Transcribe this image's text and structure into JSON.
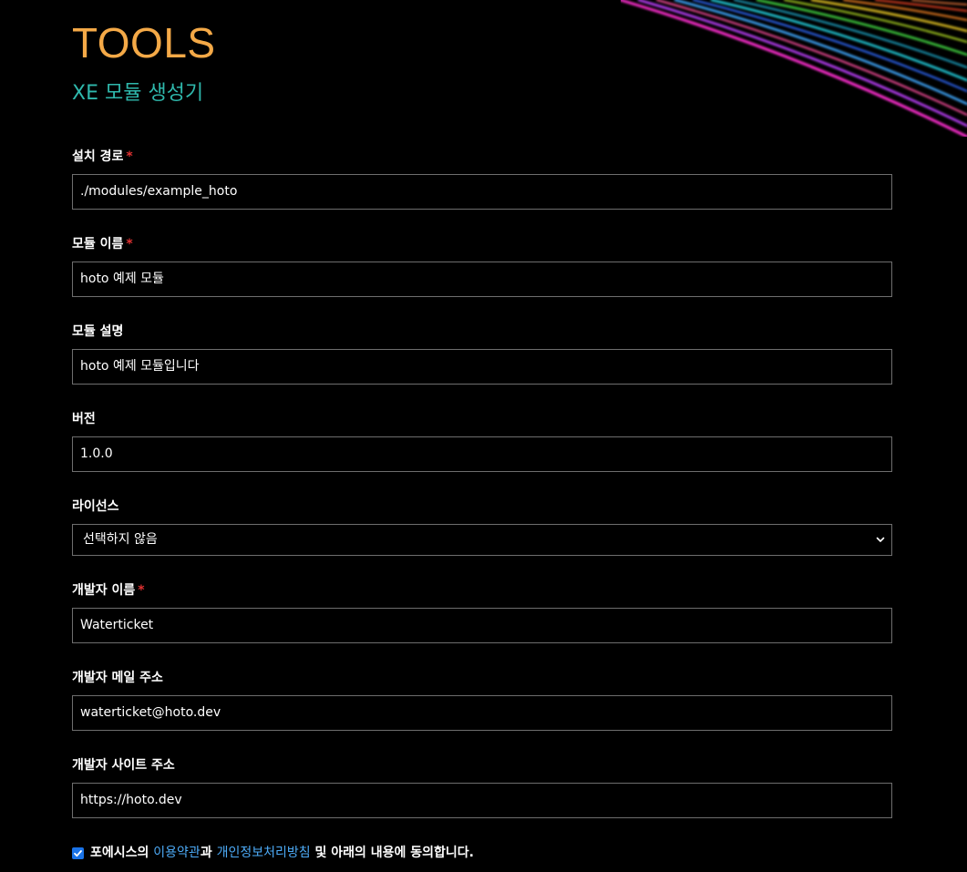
{
  "header": {
    "title": "TOOLS",
    "subtitle": "XE 모듈 생성기"
  },
  "fields": {
    "install_path": {
      "label": "설치 경로",
      "required_mark": "*",
      "value": "./modules/example_hoto"
    },
    "module_name": {
      "label": "모듈 이름",
      "required_mark": "*",
      "value": "hoto 예제 모듈"
    },
    "module_desc": {
      "label": "모듈 설명",
      "value": "hoto 예제 모듈입니다"
    },
    "version": {
      "label": "버전",
      "value": "1.0.0"
    },
    "license": {
      "label": "라이선스",
      "selected": "선택하지 않음"
    },
    "dev_name": {
      "label": "개발자 이름",
      "required_mark": "*",
      "value": "Waterticket"
    },
    "dev_email": {
      "label": "개발자 메일 주소",
      "value": "waterticket@hoto.dev"
    },
    "dev_site": {
      "label": "개발자 사이트 주소",
      "value": "https://hoto.dev"
    }
  },
  "consent": {
    "checked": true,
    "prefix": "포에시스의 ",
    "terms_link": "이용약관",
    "connector": "과 ",
    "privacy_link": "개인정보처리방침",
    "suffix": " 및 아래의 내용에 동의합니다."
  },
  "colors": {
    "title": "#f4a947",
    "subtitle": "#2fb8ac",
    "required": "#e03131",
    "link": "#4dabf7",
    "checkbox": "#1a73e8"
  }
}
